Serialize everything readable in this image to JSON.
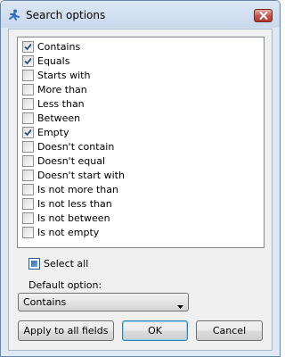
{
  "window": {
    "title": "Search options"
  },
  "options": [
    {
      "label": "Contains",
      "checked": true
    },
    {
      "label": "Equals",
      "checked": true
    },
    {
      "label": "Starts with",
      "checked": false
    },
    {
      "label": "More than",
      "checked": false
    },
    {
      "label": "Less than",
      "checked": false
    },
    {
      "label": "Between",
      "checked": false
    },
    {
      "label": "Empty",
      "checked": true
    },
    {
      "label": "Doesn't contain",
      "checked": false
    },
    {
      "label": "Doesn't equal",
      "checked": false
    },
    {
      "label": "Doesn't start with",
      "checked": false
    },
    {
      "label": "Is not more than",
      "checked": false
    },
    {
      "label": "Is not less than",
      "checked": false
    },
    {
      "label": "Is not between",
      "checked": false
    },
    {
      "label": "Is not empty",
      "checked": false
    }
  ],
  "select_all": {
    "label": "Select all",
    "state": "indeterminate"
  },
  "default_option": {
    "label": "Default option:",
    "value": "Contains"
  },
  "buttons": {
    "apply_all": "Apply to all fields",
    "ok": "OK",
    "cancel": "Cancel"
  },
  "icons": {
    "title": "search-runner-icon",
    "close": "close-icon",
    "dropdown": "chevron-down-icon"
  },
  "colors": {
    "close_button": "#c75050",
    "check_accent": "#2d6ac1"
  }
}
